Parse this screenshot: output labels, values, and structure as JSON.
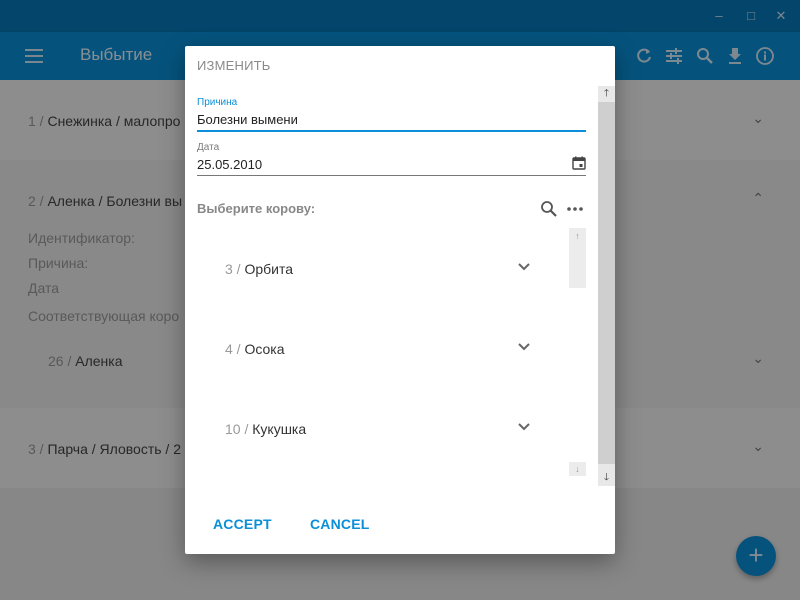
{
  "app": {
    "title": "Выбытие"
  },
  "window_controls": {
    "minimize": "–",
    "maximize": "□",
    "close": "✕"
  },
  "toolbar_icons": [
    "refresh-icon",
    "tune-icon",
    "search-icon",
    "download-icon",
    "info-icon"
  ],
  "background": {
    "rows": [
      {
        "num": "1 /",
        "text": "Снежинка / малопро"
      },
      {
        "num": "2 /",
        "text": "Аленка / Болезни вы"
      },
      {
        "num": "3 /",
        "text": "Парча / Яловость / 2"
      }
    ],
    "detail_labels": [
      "Идентификатор:",
      "Причина:",
      "Дата",
      "Соответствующая коро"
    ],
    "sub_item": {
      "num": "26 /",
      "name": "Аленка"
    }
  },
  "dialog": {
    "title": "ИЗМЕНИТЬ",
    "reason": {
      "label": "Причина",
      "value": "Болезни вымени"
    },
    "date": {
      "label": "Дата",
      "value": "25.05.2010"
    },
    "pick_label": "Выберите корову:",
    "cows": [
      {
        "num": "3 /",
        "name": "Орбита"
      },
      {
        "num": "4 /",
        "name": "Осока"
      },
      {
        "num": "10 /",
        "name": "Кукушка"
      }
    ],
    "accept": "ACCEPT",
    "cancel": "CANCEL"
  },
  "colors": {
    "accent": "#0a8fd8",
    "titlebar": "#0778b8"
  }
}
